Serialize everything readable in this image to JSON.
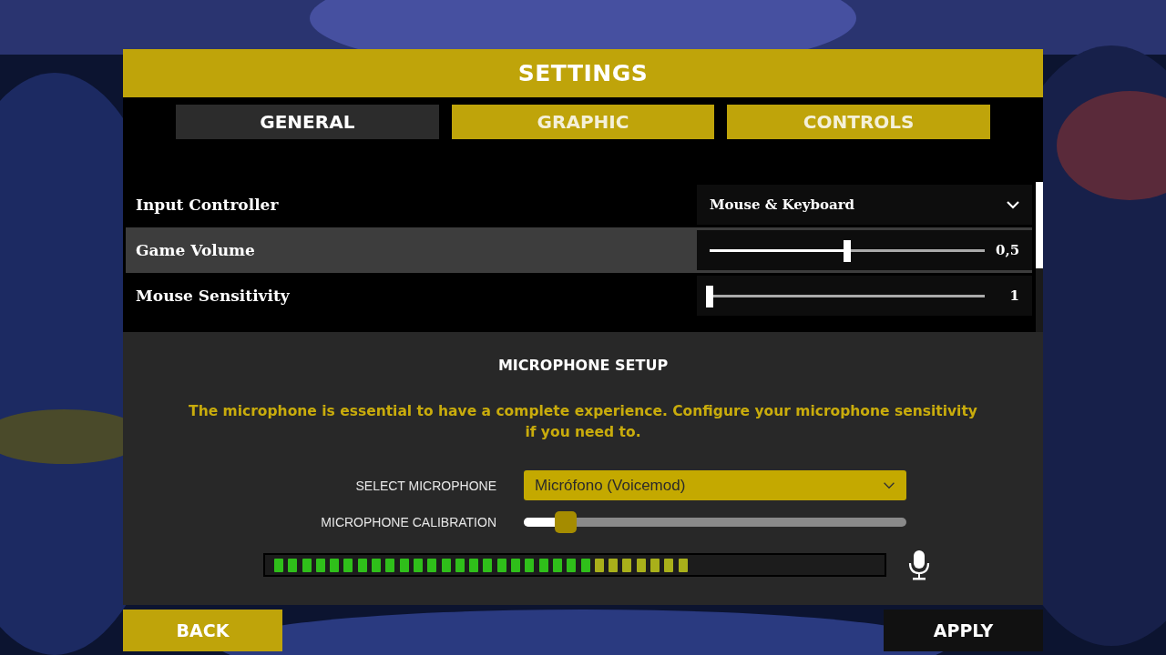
{
  "title": "SETTINGS",
  "tabs": [
    {
      "label": "GENERAL",
      "selected": true
    },
    {
      "label": "GRAPHIC",
      "selected": false
    },
    {
      "label": "CONTROLS",
      "selected": false
    }
  ],
  "settings": [
    {
      "kind": "dropdown",
      "label": "Input Controller",
      "value": "Mouse & Keyboard",
      "selected": false
    },
    {
      "kind": "slider",
      "label": "Game Volume",
      "level": 0.5,
      "reading": "0,5",
      "selected": true
    },
    {
      "kind": "slider",
      "label": "Mouse Sensitivity",
      "level": 0,
      "reading": "1",
      "selected": false
    }
  ],
  "microphone": {
    "heading": "MICROPHONE SETUP",
    "notice": "The microphone is essential to have a complete experience. Configure your microphone sensitivity if you need to.",
    "select_label": "SELECT MICROPHONE",
    "device": "Micrófono (Voicemod)",
    "calibration_label": "MICROPHONE CALIBRATION",
    "calibration": {
      "level": 0.08
    },
    "meter": {
      "level": 0.7
    }
  },
  "buttons": [
    {
      "label": "BACK",
      "kind": "back"
    },
    {
      "label": "APPLY",
      "kind": "apply"
    }
  ]
}
